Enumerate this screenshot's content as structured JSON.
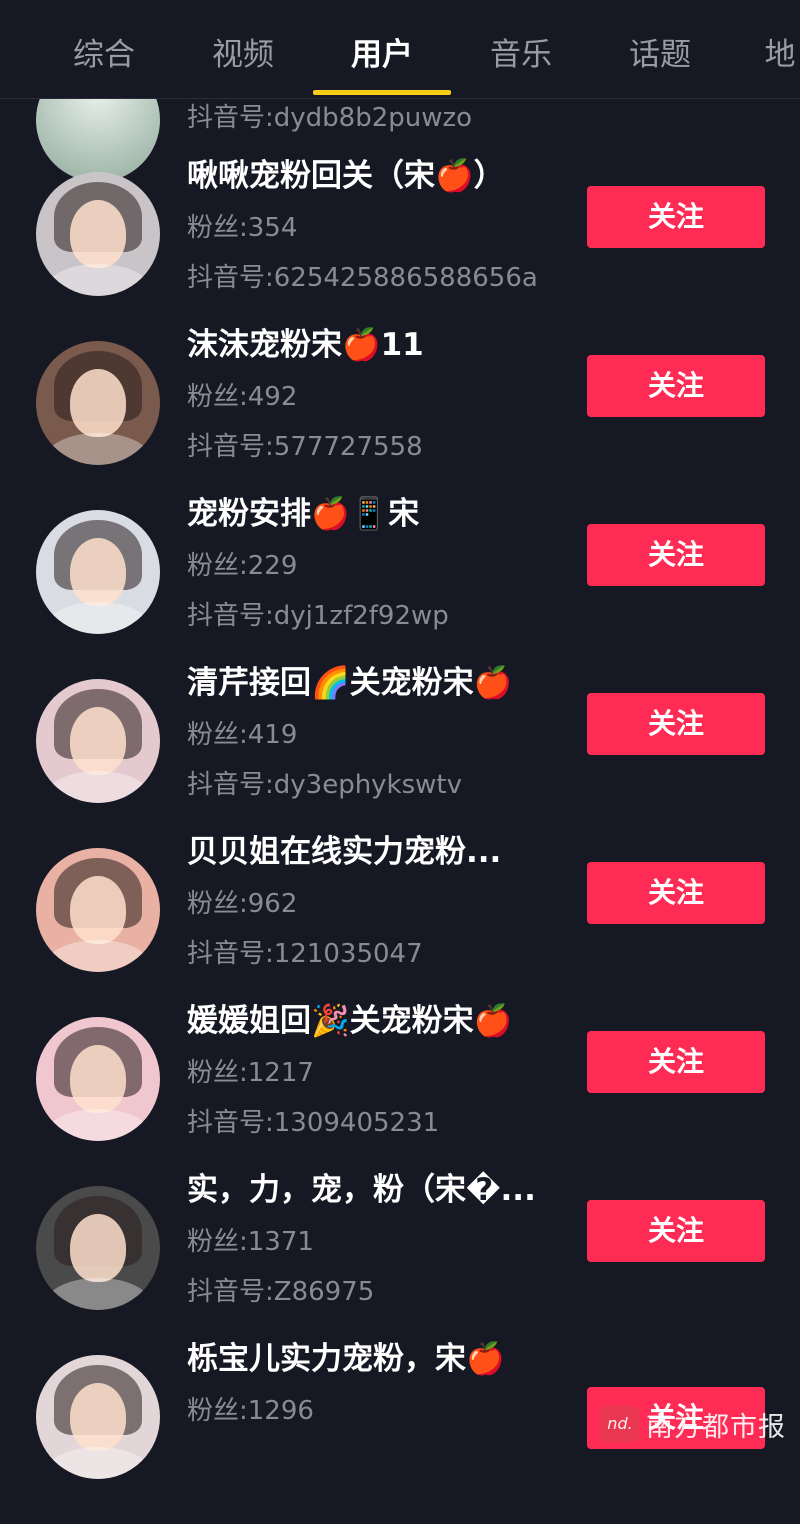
{
  "tabs": [
    "综合",
    "视频",
    "用户",
    "音乐",
    "话题",
    "地"
  ],
  "active_tab": "用户",
  "partial_row": {
    "douyin_id": "抖音号:dydb8b2puwzo"
  },
  "users": [
    {
      "name": "啾啾宠粉回关（宋🍎）",
      "fans": "粉丝:354",
      "douyin_id": "抖音号:625425886588656a",
      "follow_label": "关注",
      "avatar_bg": "#c9c4c8"
    },
    {
      "name": "沫沫宠粉宋🍎11",
      "fans": "粉丝:492",
      "douyin_id": "抖音号:577727558",
      "follow_label": "关注",
      "avatar_bg": "#7a5a4c"
    },
    {
      "name": "宠粉安排🍎📱宋",
      "fans": "粉丝:229",
      "douyin_id": "抖音号:dyj1zf2f92wp",
      "follow_label": "关注",
      "avatar_bg": "#d9dce2"
    },
    {
      "name": "清芹接回🌈关宠粉宋🍎",
      "fans": "粉丝:419",
      "douyin_id": "抖音号:dy3ephykswtv",
      "follow_label": "关注",
      "avatar_bg": "#e4c9cf"
    },
    {
      "name": "贝贝姐在线实力宠粉...",
      "fans": "粉丝:962",
      "douyin_id": "抖音号:121035047",
      "follow_label": "关注",
      "avatar_bg": "#e8b1a3"
    },
    {
      "name": "媛媛姐回🎉关宠粉宋🍎",
      "fans": "粉丝:1217",
      "douyin_id": "抖音号:1309405231",
      "follow_label": "关注",
      "avatar_bg": "#f0c6cf"
    },
    {
      "name": "实，力，宠，粉（宋�...",
      "fans": "粉丝:1371",
      "douyin_id": "抖音号:Z86975",
      "follow_label": "关注",
      "avatar_bg": "#4a4a4a"
    },
    {
      "name": "栎宝儿实力宠粉，宋🍎",
      "fans": "粉丝:1296",
      "douyin_id": "",
      "follow_label": "关注",
      "avatar_bg": "#e3d6d8"
    }
  ],
  "watermark": {
    "logo": "nd.",
    "text": "南方都市报"
  },
  "colors": {
    "background": "#161823",
    "follow_button": "#fe2c55",
    "tab_underline": "#face15",
    "secondary_text": "#8a8b92"
  }
}
